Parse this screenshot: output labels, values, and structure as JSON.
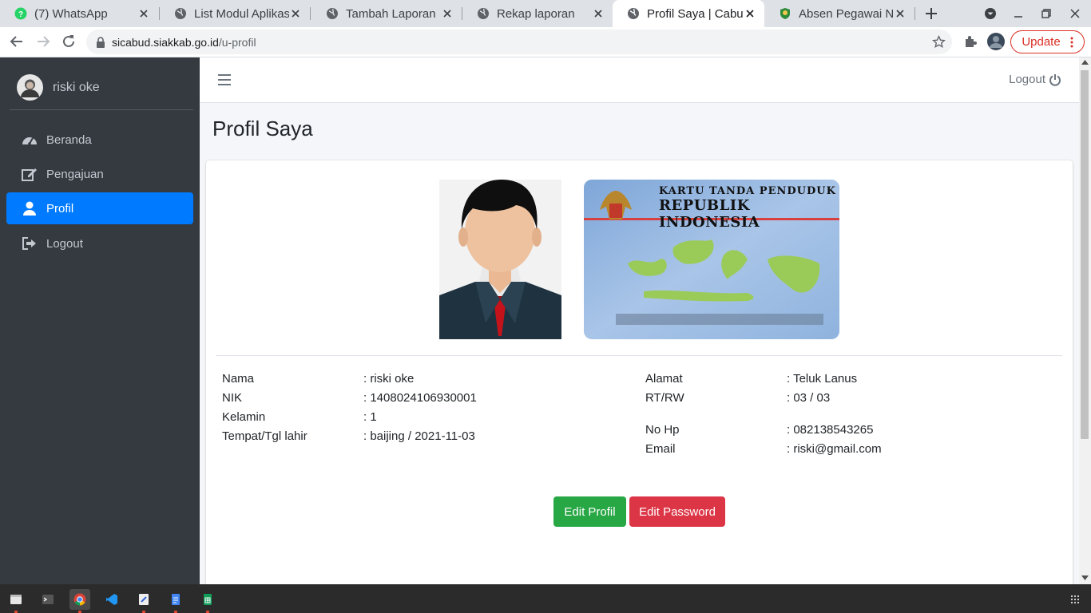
{
  "browser": {
    "tabs": [
      {
        "title": "(7) WhatsApp",
        "icon": "whatsapp-icon",
        "active": false
      },
      {
        "title": "List Modul Aplikas",
        "icon": "globe-icon",
        "active": false
      },
      {
        "title": "Tambah Laporan",
        "icon": "globe-icon",
        "active": false
      },
      {
        "title": "Rekap laporan",
        "icon": "globe-icon",
        "active": false
      },
      {
        "title": "Profil Saya | Cabut",
        "icon": "globe-icon",
        "active": true
      },
      {
        "title": "Absen Pegawai Nc",
        "icon": "shield-logo-icon",
        "active": false
      }
    ],
    "url_host": "sicabud.siakkab.go.id",
    "url_path": "/u-profil",
    "update_label": "Update"
  },
  "sidebar": {
    "user_name": "riski oke",
    "items": [
      {
        "label": "Beranda",
        "icon": "dashboard-icon",
        "active": false
      },
      {
        "label": "Pengajuan",
        "icon": "edit-icon",
        "active": false
      },
      {
        "label": "Profil",
        "icon": "user-icon",
        "active": true
      },
      {
        "label": "Logout",
        "icon": "sign-out-icon",
        "active": false
      }
    ]
  },
  "topnav": {
    "logout_label": "Logout"
  },
  "page": {
    "title": "Profil Saya"
  },
  "ktp": {
    "line1": "KARTU TANDA PENDUDUK",
    "line2": "REPUBLIK INDONESIA"
  },
  "profile": {
    "left": [
      {
        "label": "Nama",
        "value": ": riski oke"
      },
      {
        "label": "NIK",
        "value": ": 1408024106930001"
      },
      {
        "label": "Kelamin",
        "value": ": 1"
      },
      {
        "label": "Tempat/Tgl lahir",
        "value": ": baijing / 2021-11-03"
      }
    ],
    "right": [
      {
        "label": "Alamat",
        "value": ": Teluk Lanus"
      },
      {
        "label": "RT/RW",
        "value": ": 03 / 03"
      },
      {
        "label": "No Hp",
        "value": ": 082138543265"
      },
      {
        "label": "Email",
        "value": ": riski@gmail.com"
      }
    ]
  },
  "buttons": {
    "edit_profil": "Edit Profil",
    "edit_password": "Edit Password"
  },
  "colors": {
    "sidebar": "#343a40",
    "primary": "#007bff",
    "success": "#28a745",
    "danger": "#dc3545"
  }
}
